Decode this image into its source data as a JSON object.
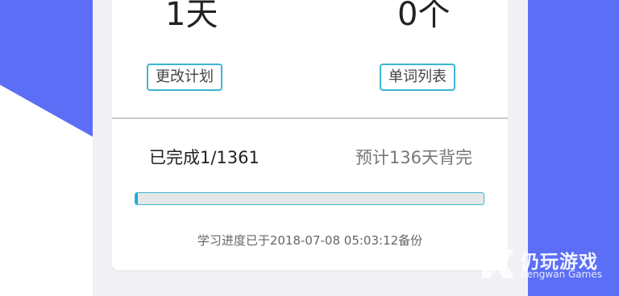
{
  "stats": {
    "days_value": "1天",
    "words_value": "0个"
  },
  "actions": {
    "change_plan_label": "更改计划",
    "word_list_label": "单词列表"
  },
  "progress": {
    "completed_text": "已完成1/1361",
    "estimate_text": "预计136天背完",
    "completed": 1,
    "total": 1361
  },
  "backup": {
    "text": "学习进度已于2018-07-08 05:03:12备份"
  },
  "watermark": {
    "name_cn": "仍玩游戏",
    "name_en": "Rengwan Games"
  },
  "colors": {
    "accent_blue": "#5b6ef5",
    "button_border": "#3bb6d3",
    "progress_fill": "#22a7d9"
  }
}
